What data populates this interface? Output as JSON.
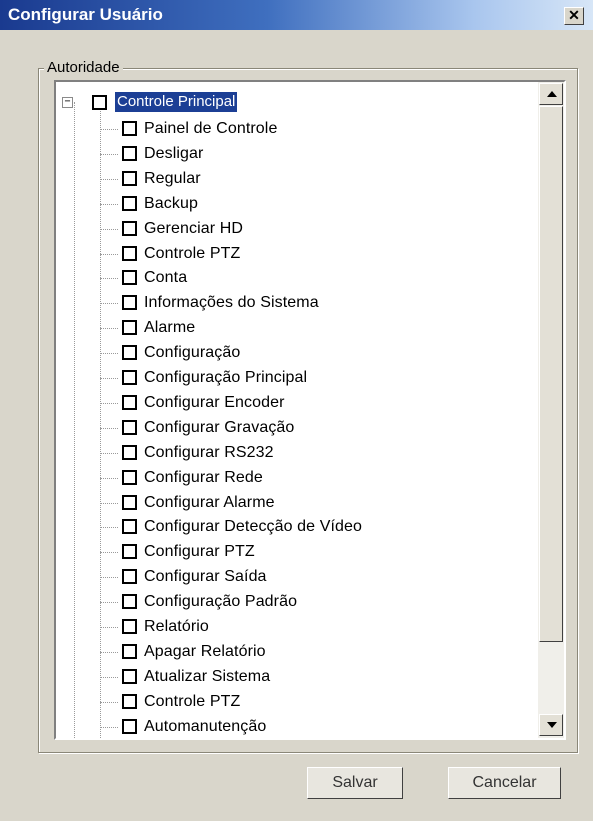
{
  "window": {
    "title": "Configurar Usuário",
    "close_glyph": "✕"
  },
  "group": {
    "label": "Autoridade"
  },
  "tree": {
    "root": {
      "label": "Controle Principal",
      "expander": "−",
      "checked": false
    },
    "items": [
      "Painel de Controle",
      "Desligar",
      "Regular",
      "Backup",
      "Gerenciar HD",
      "Controle PTZ",
      "Conta",
      "Informações do Sistema",
      "Alarme",
      "Configuração",
      "Configuração Principal",
      "Configurar Encoder",
      "Configurar Gravação",
      "Configurar RS232",
      "Configurar Rede",
      "Configurar Alarme",
      "Configurar Detecção de Vídeo",
      "Configurar PTZ",
      "Configurar Saída",
      "Configuração Padrão",
      "Relatório",
      "Apagar Relatório",
      "Atualizar Sistema",
      "Controle PTZ",
      "Automanutenção",
      ""
    ]
  },
  "buttons": {
    "save": "Salvar",
    "cancel": "Cancelar"
  },
  "colors": {
    "selection": "#1c3f95",
    "title_gradient_start": "#1a3a8f"
  }
}
